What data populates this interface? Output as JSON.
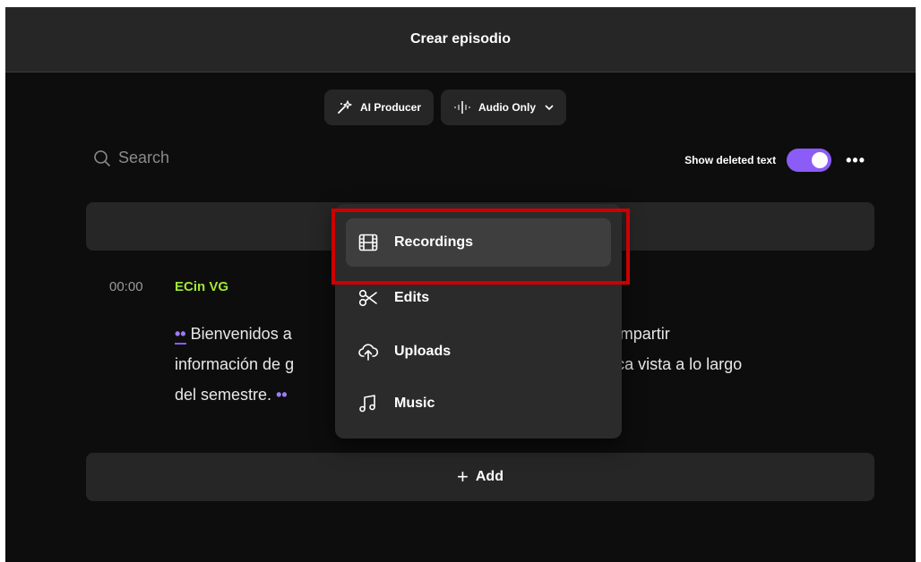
{
  "window": {
    "title": "Crear episodio"
  },
  "toolbar": {
    "ai_producer_label": "AI Producer",
    "audio_mode_label": "Audio Only"
  },
  "search": {
    "placeholder": "Search"
  },
  "options": {
    "show_deleted_label": "Show deleted text",
    "show_deleted_on": true,
    "more_label": "•••"
  },
  "transcript": {
    "timestamp": "00:00",
    "speaker": "ECin VG",
    "marker": "••",
    "lines": [
      "Bienvenidos a",
      "para compartir",
      "información de g",
      "mática vista a lo largo",
      "del semestre."
    ]
  },
  "add_button": {
    "label": "Add"
  },
  "dropdown": {
    "items": [
      {
        "label": "Recordings",
        "icon": "film-icon",
        "active": true
      },
      {
        "label": "Edits",
        "icon": "scissors-icon"
      },
      {
        "label": "Uploads",
        "icon": "cloud-upload-icon"
      },
      {
        "label": "Music",
        "icon": "music-note-icon"
      }
    ]
  },
  "colors": {
    "accent": "#8b5cf6",
    "speaker": "#a3e635",
    "highlight": "#cc0000"
  }
}
